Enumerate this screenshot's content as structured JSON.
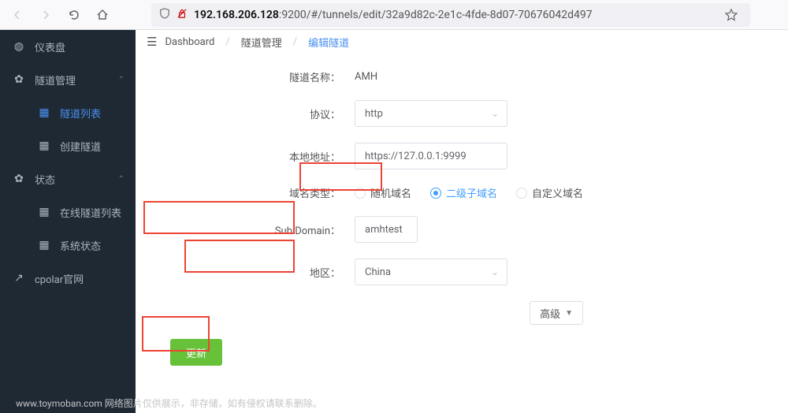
{
  "browser": {
    "url_host": "192.168.206.128",
    "url_rest": ":9200/#/tunnels/edit/32a9d82c-2e1c-4fde-8d07-70676042d497"
  },
  "sidebar": {
    "items": [
      {
        "label": "仪表盘",
        "icon": "◕",
        "sub": false,
        "active": false,
        "chev": false
      },
      {
        "label": "隧道管理",
        "icon": "✿",
        "sub": false,
        "active": false,
        "chev": true
      },
      {
        "label": "隧道列表",
        "icon": "▦",
        "sub": true,
        "active": true,
        "chev": false
      },
      {
        "label": "创建隧道",
        "icon": "▦",
        "sub": true,
        "active": false,
        "chev": false
      },
      {
        "label": "状态",
        "icon": "✿",
        "sub": false,
        "active": false,
        "chev": true
      },
      {
        "label": "在线隧道列表",
        "icon": "▦",
        "sub": true,
        "active": false,
        "chev": false
      },
      {
        "label": "系统状态",
        "icon": "▦",
        "sub": true,
        "active": false,
        "chev": false
      },
      {
        "label": "cpolar官网",
        "icon": "↗",
        "sub": false,
        "active": false,
        "chev": false
      }
    ]
  },
  "breadcrumb": {
    "root": "Dashboard",
    "mid": "隧道管理",
    "leaf": "编辑隧道"
  },
  "form": {
    "name_label": "隧道名称：",
    "name_value": "AMH",
    "proto_label": "协议：",
    "proto_value": "http",
    "addr_label": "本地地址：",
    "addr_value": "https://127.0.0.1:9999",
    "domain_type_label": "域名类型：",
    "domain_options": [
      "随机域名",
      "二级子域名",
      "自定义域名"
    ],
    "domain_selected": 1,
    "subdomain_label": "Sub Domain：",
    "subdomain_value": "amhtest",
    "region_label": "地区：",
    "region_value": "China",
    "advanced_label": "高级",
    "submit_label": "更新"
  },
  "watermark": "www.toymoban.com 网络图片仅供展示，非存储，如有侵权请联系删除。"
}
